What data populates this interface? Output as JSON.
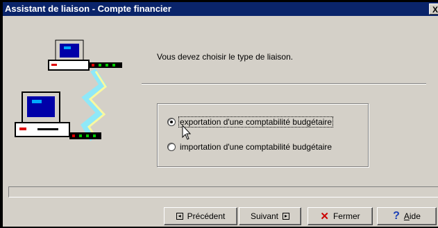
{
  "window": {
    "title": "Assistant de liaison - Compte financier",
    "close_glyph": "X"
  },
  "instruction": "Vous devez choisir le type de liaison.",
  "options": [
    {
      "label": "exportation d'une comptabilité budgétaire",
      "selected": true
    },
    {
      "label": "importation d'une comptabilité budgétaire",
      "selected": false
    }
  ],
  "buttons": {
    "previous": {
      "label": "Précédent",
      "icon": "arrow-left-icon"
    },
    "next": {
      "label": "Suivant",
      "icon": "arrow-right-icon"
    },
    "close": {
      "label": "Fermer",
      "icon": "x-icon"
    },
    "help": {
      "label_first": "A",
      "label_rest": "ide",
      "icon": "question-icon"
    }
  },
  "colors": {
    "titlebar": "#0a246a",
    "face": "#d4d0c8",
    "close_x": "#cc0000",
    "help_q": "#1a3fb5"
  }
}
